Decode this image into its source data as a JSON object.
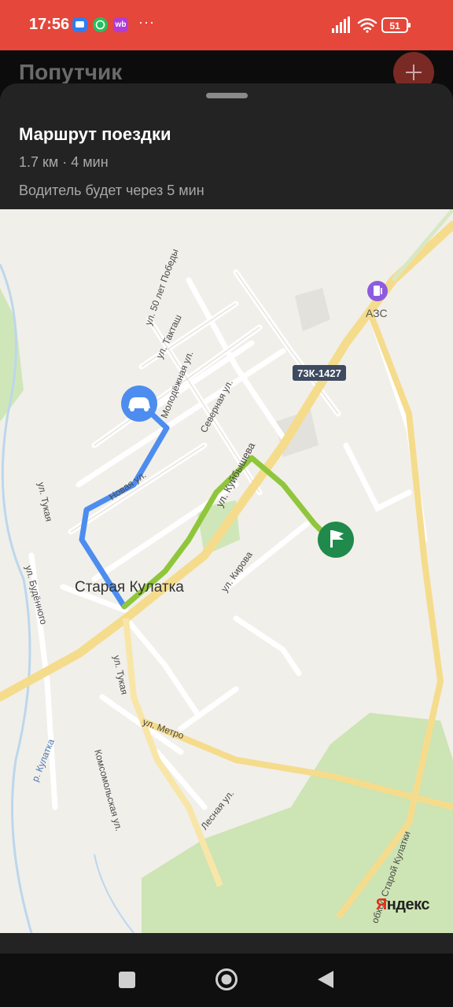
{
  "status_bar": {
    "time": "17:56",
    "icons": [
      "message-icon",
      "whatsapp-icon",
      "wb-icon"
    ],
    "wb_badge": "wb",
    "more": "···",
    "battery": "51",
    "accent_color": "#e5473b"
  },
  "app": {
    "title": "Попутчик",
    "add_button_icon": "plus-icon"
  },
  "route": {
    "title": "Маршрут поездки",
    "summary": "1.7 км · 4 мин",
    "driver_eta": "Водитель будет через 5 мин"
  },
  "map": {
    "route_colors": {
      "driver_path": "#4c8def",
      "trip_path": "#8fc63b",
      "destination": "#1f8a4c"
    },
    "town_label": "Старая Кулатка",
    "poi_label": "АЗС",
    "road_shield": "73К-1427",
    "streets": [
      "ул. 50 лет Победы",
      "ул. Такташ",
      "Молодёжная ул.",
      "Северная ул.",
      "Новая ул.",
      "ул. Куйбышева",
      "ул. Кирова",
      "ул. Тукая",
      "ул. Тукая",
      "ул. Будённого",
      "ул. Метро",
      "Комсомольская ул.",
      "Лесная ул.",
      "обход Старой Кулатки",
      "р. Кулатка"
    ],
    "attribution": "Яндекс"
  },
  "nav": {
    "recents": "square-icon",
    "home": "circle-icon",
    "back": "triangle-back-icon"
  }
}
